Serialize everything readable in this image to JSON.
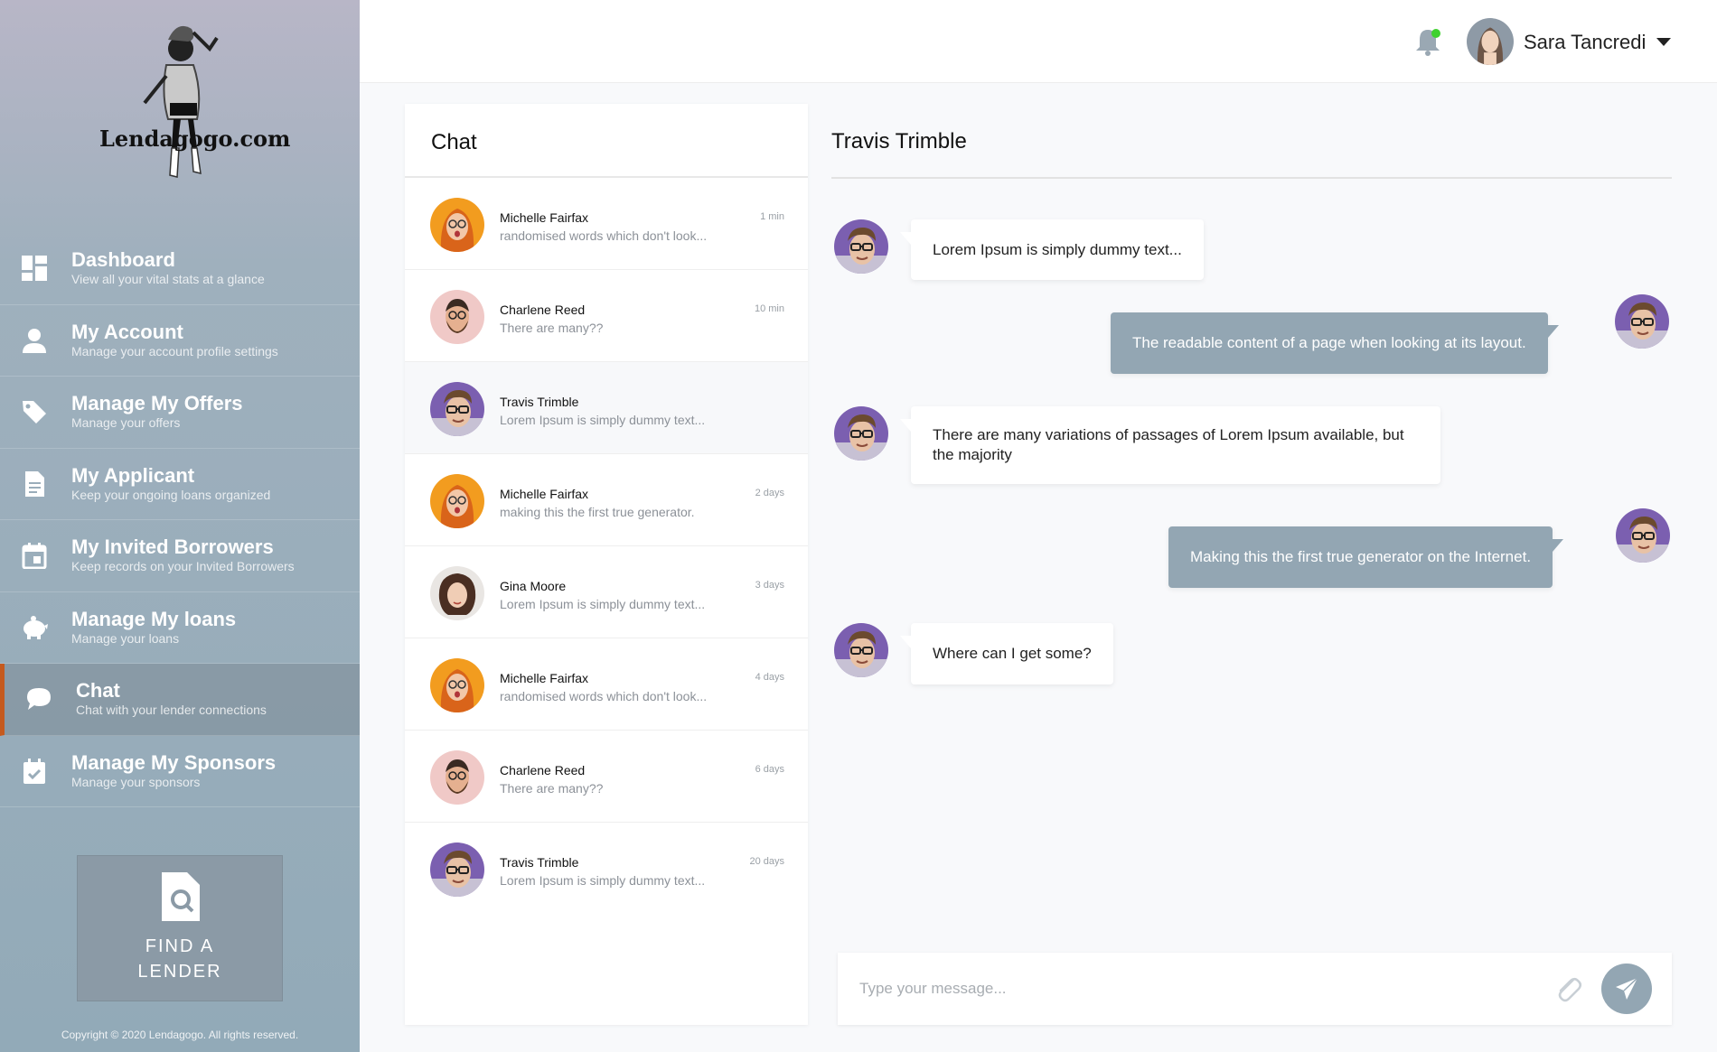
{
  "brand": {
    "logo_text": "Lendagogo.com"
  },
  "sidebar": {
    "items": [
      {
        "title": "Dashboard",
        "subtitle": "View all your vital stats at a glance",
        "icon": "dashboard-icon"
      },
      {
        "title": "My Account",
        "subtitle": "Manage your account profile settings",
        "icon": "user-icon"
      },
      {
        "title": "Manage My Offers",
        "subtitle": "Manage your offers",
        "icon": "tag-icon"
      },
      {
        "title": "My Applicant",
        "subtitle": "Keep your ongoing loans organized",
        "icon": "document-icon"
      },
      {
        "title": "My Invited Borrowers",
        "subtitle": "Keep records on your Invited Borrowers",
        "icon": "calendar-icon"
      },
      {
        "title": "Manage My loans",
        "subtitle": "Manage your loans",
        "icon": "piggy-bank-icon"
      },
      {
        "title": "Chat",
        "subtitle": "Chat with your lender connections",
        "icon": "chat-icon",
        "active": true
      },
      {
        "title": "Manage My Sponsors",
        "subtitle": "Manage  your sponsors",
        "icon": "calendar-check-icon"
      }
    ],
    "find_lender": "FIND A\nLENDER",
    "copyright": "Copyright © 2020 Lendagogo. All rights reserved."
  },
  "header": {
    "user_name": "Sara Tancredi",
    "notification_status_color": "#3fd12f"
  },
  "chat_list": {
    "title": "Chat",
    "conversations": [
      {
        "name": "Michelle Fairfax",
        "preview": "randomised words which don't look...",
        "time": "1 min"
      },
      {
        "name": "Charlene Reed",
        "preview": "There are many??",
        "time": "10 min"
      },
      {
        "name": "Travis Trimble",
        "preview": "Lorem Ipsum is simply dummy text...",
        "time": "",
        "active": true
      },
      {
        "name": "Michelle Fairfax",
        "preview": "making this the first true generator.",
        "time": "2 days"
      },
      {
        "name": "Gina Moore",
        "preview": "Lorem Ipsum is simply dummy text...",
        "time": "3 days"
      },
      {
        "name": "Michelle Fairfax",
        "preview": "randomised words which don't look...",
        "time": "4 days"
      },
      {
        "name": "Charlene Reed",
        "preview": "There are many??",
        "time": "6 days"
      },
      {
        "name": "Travis Trimble",
        "preview": "Lorem Ipsum is simply dummy text...",
        "time": "20 days"
      }
    ]
  },
  "conversation": {
    "title": "Travis Trimble",
    "messages": [
      {
        "direction": "incoming",
        "text": "Lorem Ipsum is simply dummy text..."
      },
      {
        "direction": "outgoing",
        "text": "The readable content of a page when looking at its layout."
      },
      {
        "direction": "incoming",
        "text": "There are many variations of passages of Lorem Ipsum available, but the majority"
      },
      {
        "direction": "outgoing",
        "text": "Making this the first true generator on the Internet."
      },
      {
        "direction": "incoming",
        "text": "Where can I get some?"
      }
    ],
    "composer": {
      "placeholder": "Type your message..."
    }
  },
  "colors": {
    "accent": "#93a6b3",
    "active_indicator": "#c55a1e"
  }
}
